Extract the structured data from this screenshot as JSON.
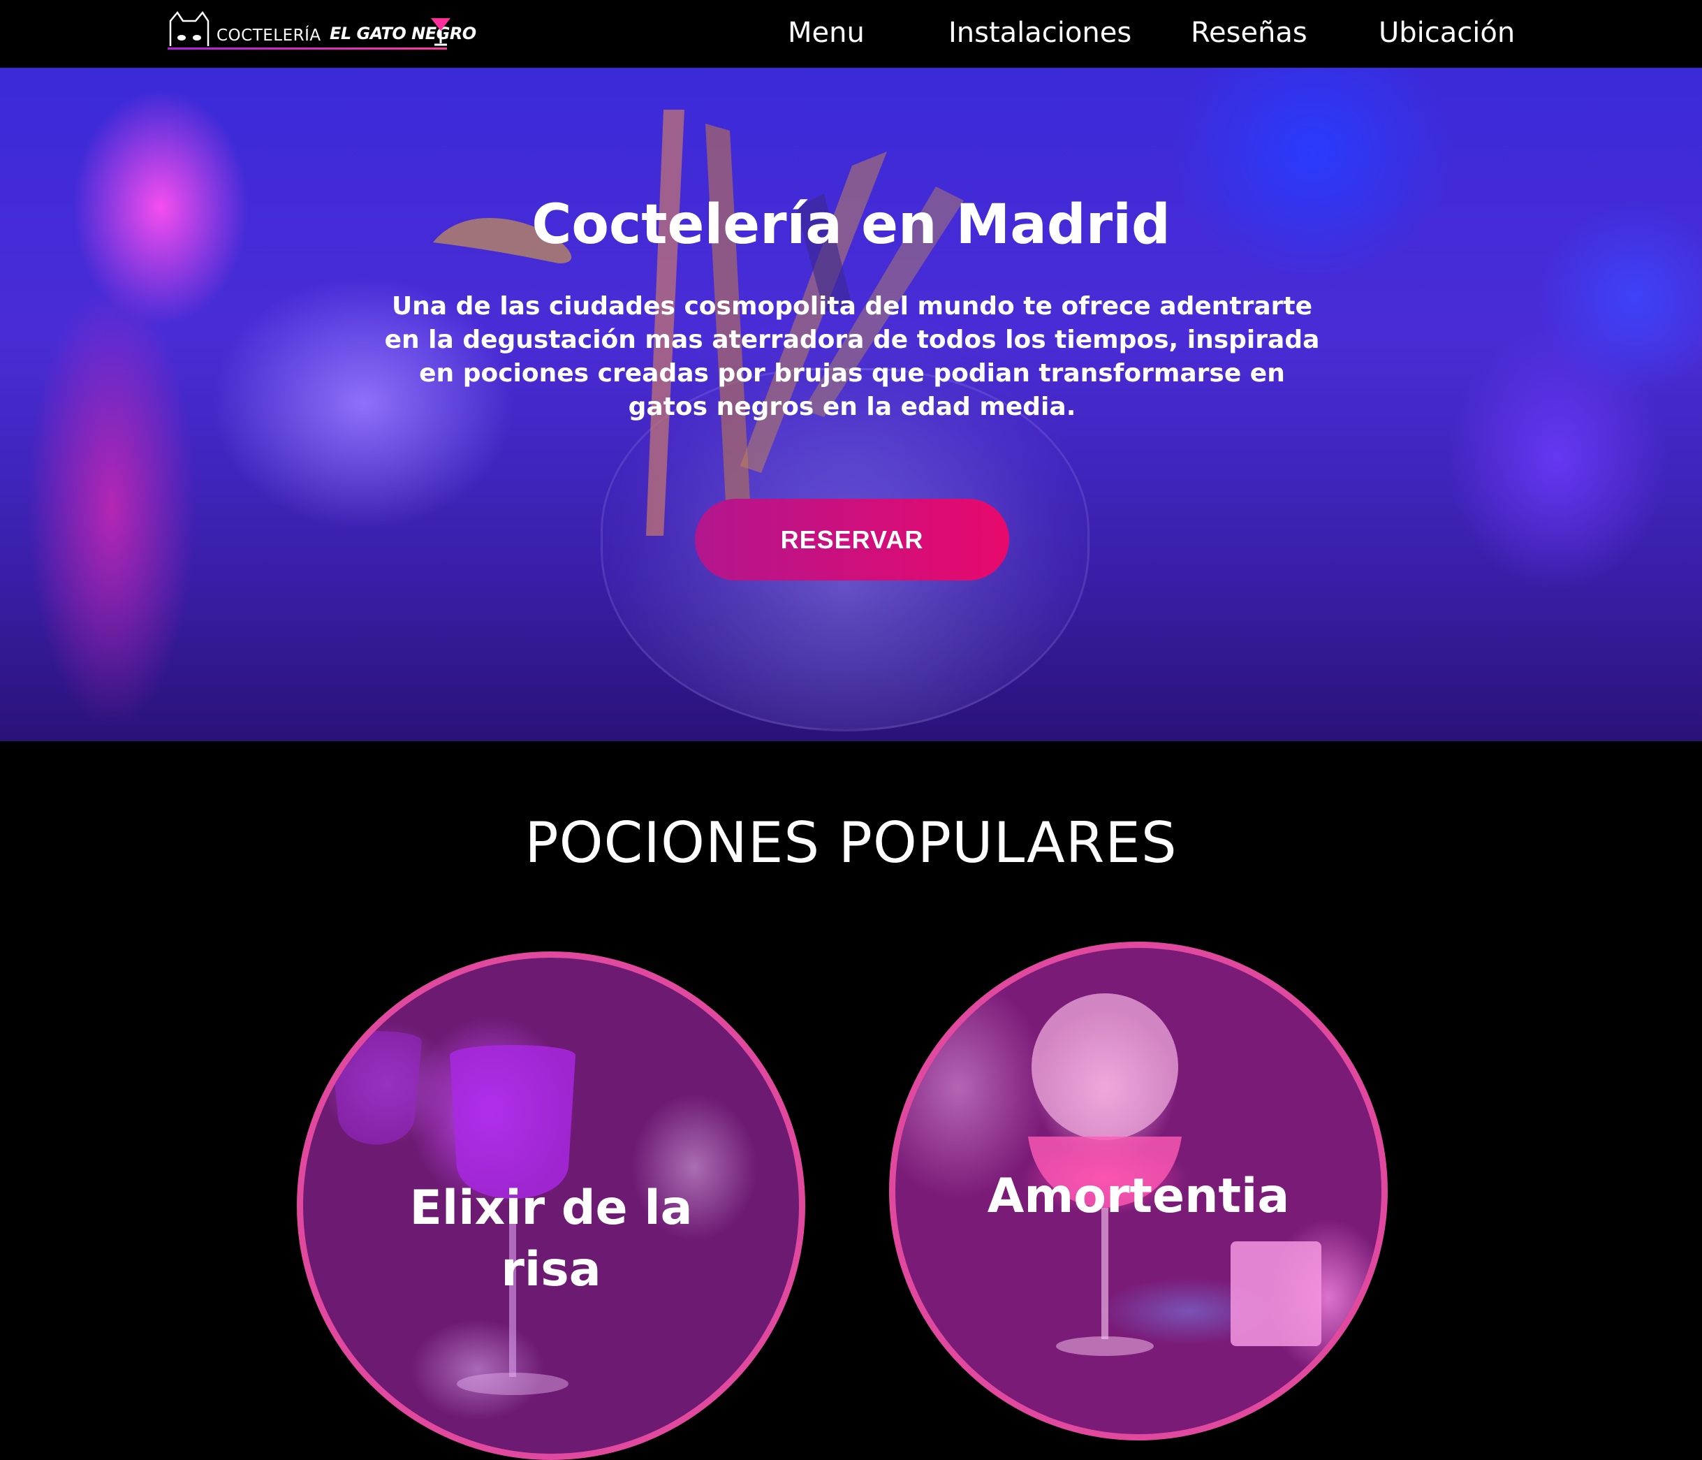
{
  "brand": {
    "prefix": "COCTELERÍA",
    "name": "EL GATO NEGRO"
  },
  "nav": {
    "items": [
      {
        "label": "Menu"
      },
      {
        "label": "Instalaciones"
      },
      {
        "label": "Reseñas"
      },
      {
        "label": "Ubicación"
      }
    ]
  },
  "hero": {
    "title": "Coctelería en Madrid",
    "description": "Una de las ciudades cosmopolita del mundo te ofrece adentrarte en la degustación mas aterradora de todos los tiempos, inspirada en pociones creadas por brujas que podian transformarse en gatos negros en la edad media.",
    "cta_label": "RESERVAR"
  },
  "potions": {
    "title": "POCIONES POPULARES",
    "items": [
      {
        "name": "Elixir de la risa"
      },
      {
        "name": "Amortentia"
      }
    ]
  },
  "colors": {
    "accent": "#e0499e",
    "button_start": "#b2168e",
    "button_end": "#e8096c",
    "background": "#000000"
  }
}
